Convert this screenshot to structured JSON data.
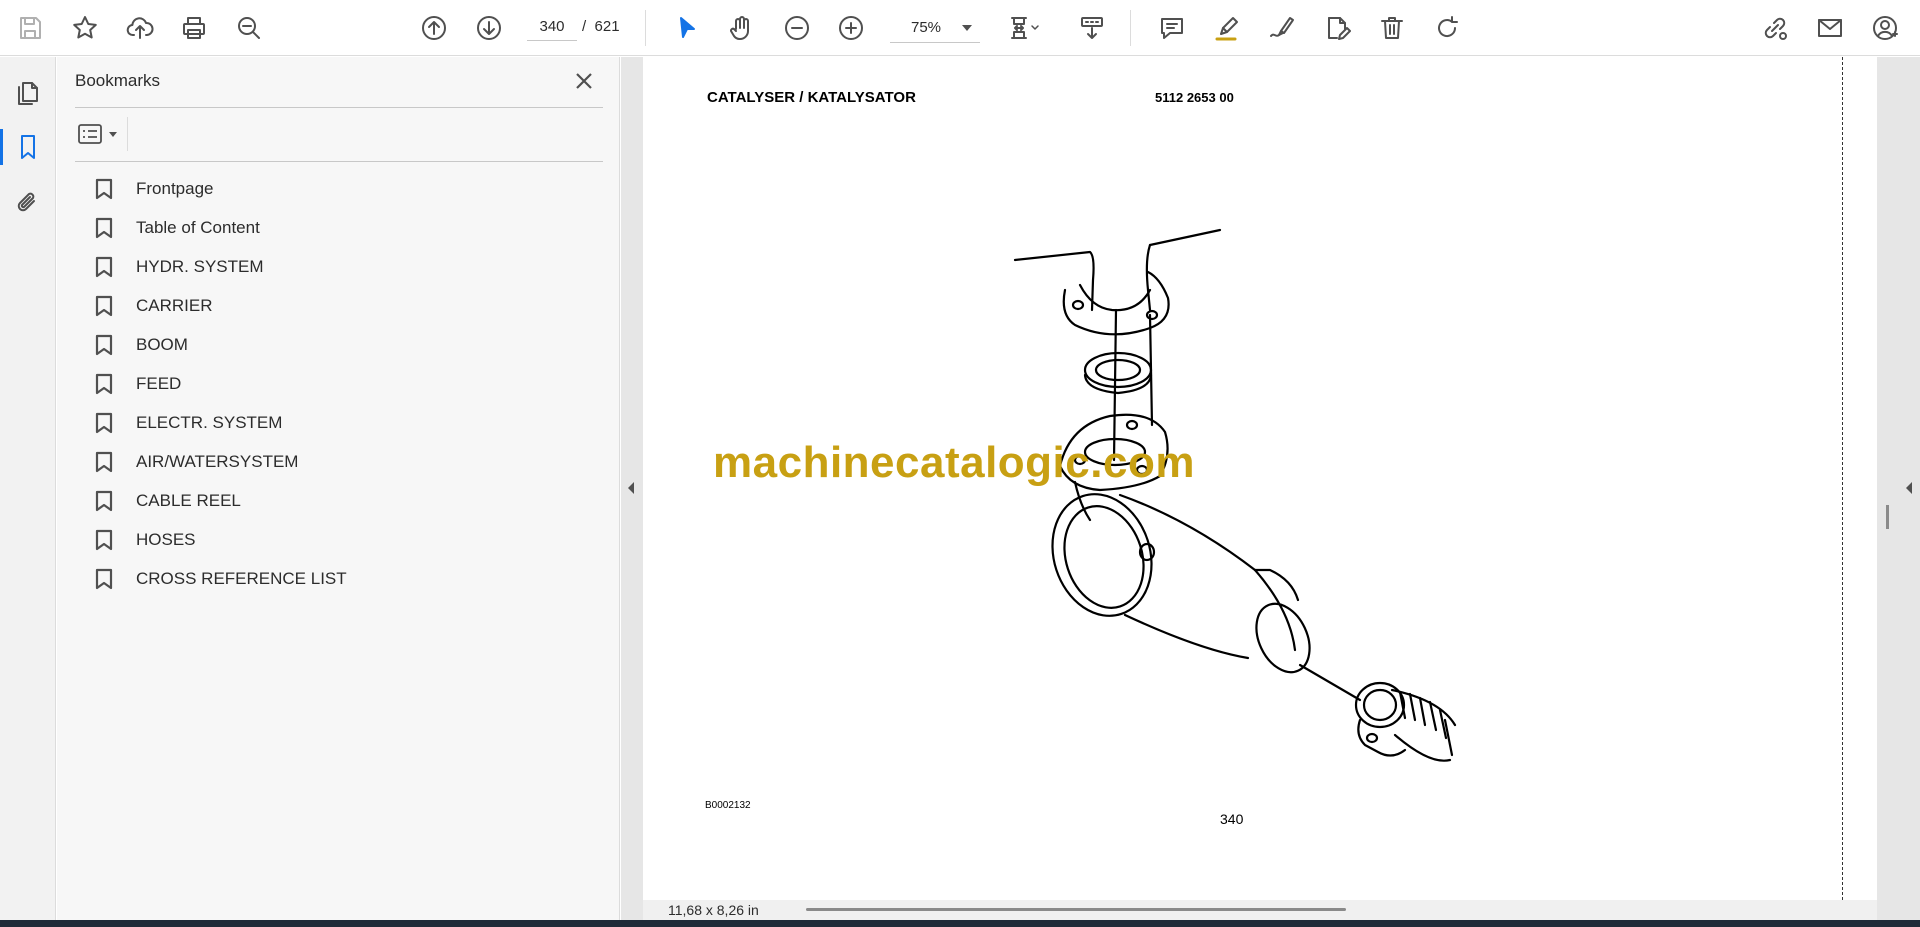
{
  "toolbar": {
    "current_page": "340",
    "page_separator": "/",
    "total_pages": "621",
    "zoom": "75%",
    "icons": [
      "save-icon",
      "star-icon",
      "upload-icon",
      "print-icon",
      "find-icon",
      "page-up-icon",
      "page-down-icon",
      "select-cursor-icon",
      "hand-icon",
      "zoom-out-icon",
      "zoom-in-icon",
      "fit-page-icon",
      "scroll-mode-icon",
      "comment-icon",
      "highlight-icon",
      "draw-icon",
      "edit-pdf-icon",
      "delete-icon",
      "rotate-icon",
      "share-link-icon",
      "email-icon",
      "account-icon"
    ],
    "accent": "#1473e6"
  },
  "sidebar": {
    "title": "Bookmarks",
    "bookmarks": [
      "Frontpage",
      "Table of Content",
      "HYDR. SYSTEM",
      "CARRIER",
      "BOOM",
      "FEED",
      "ELECTR. SYSTEM",
      "AIR/WATERSYSTEM",
      "CABLE REEL",
      "HOSES",
      "CROSS REFERENCE LIST"
    ]
  },
  "document": {
    "title": "CATALYSER / KATALYSATOR",
    "part_number": "5112 2653 00",
    "watermark": "machinecatalogic.com",
    "figure_code": "B0002132",
    "page_number": "340",
    "watermark_color": "#c8a013"
  },
  "status": {
    "page_size": "11,68 x 8,26 in"
  }
}
